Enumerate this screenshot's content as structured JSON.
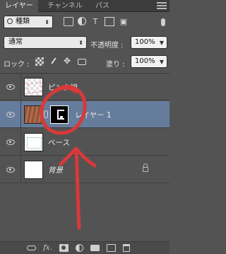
{
  "tabs": [
    {
      "label": "レイヤー",
      "active": true
    },
    {
      "label": "チャンネル",
      "active": false
    },
    {
      "label": "パス",
      "active": false
    }
  ],
  "filter": {
    "kind_label": "種類",
    "icons": [
      "image-filter-icon",
      "adjustment-filter-icon",
      "type-filter-icon",
      "shape-filter-icon",
      "smart-object-filter-icon"
    ]
  },
  "blend": {
    "mode": "通常",
    "opacity_label": "不透明度 :",
    "opacity_value": "100%"
  },
  "lock": {
    "label": "ロック :",
    "fill_label": "塗り :",
    "fill_value": "100%"
  },
  "layers": [
    {
      "name": "ピンク線",
      "selected": false,
      "visible": true
    },
    {
      "name": "レイヤー 1",
      "selected": true,
      "visible": true
    },
    {
      "name": "ベース",
      "selected": false,
      "visible": true
    },
    {
      "name": "背景",
      "selected": false,
      "visible": true,
      "locked": true
    }
  ],
  "bottom_icons": [
    "link-icon",
    "fx-icon",
    "add-mask-icon",
    "adjustment-icon",
    "new-group-icon",
    "new-layer-icon",
    "trash-icon"
  ],
  "bottom_fx_label": "fx.",
  "colors": {
    "panel_bg": "#535353",
    "selected_row": "#667c9c",
    "annotation_red": "#d63a3a"
  }
}
